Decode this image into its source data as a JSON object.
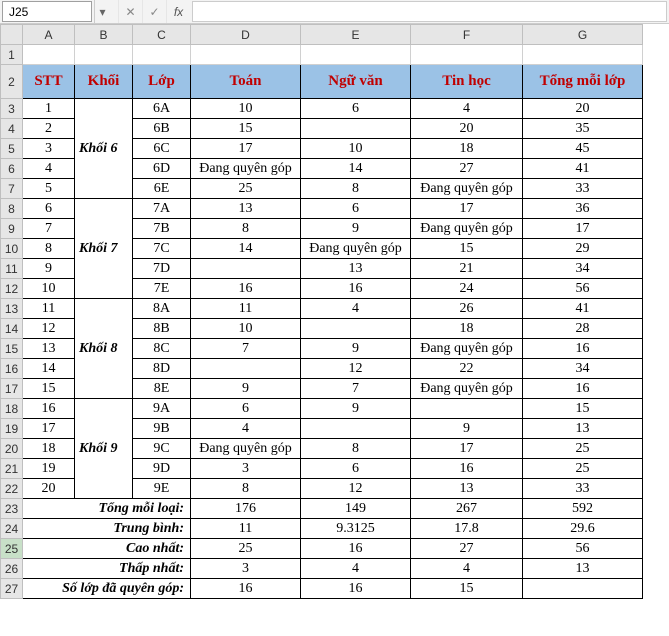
{
  "formula_bar": {
    "name_box": "J25",
    "cancel_icon": "✕",
    "enter_icon": "✓",
    "fx_label": "fx",
    "value": ""
  },
  "col_headers": [
    "A",
    "B",
    "C",
    "D",
    "E",
    "F",
    "G"
  ],
  "row_numbers": [
    1,
    2,
    3,
    4,
    5,
    6,
    7,
    8,
    9,
    10,
    11,
    12,
    13,
    14,
    15,
    16,
    17,
    18,
    19,
    20,
    21,
    22,
    23,
    24,
    25,
    26,
    27
  ],
  "headers": {
    "stt": "STT",
    "khoi": "Khối",
    "lop": "Lớp",
    "toan": "Toán",
    "nguvan": "Ngữ văn",
    "tinhoc": "Tin học",
    "tong": "Tổng mỗi lớp"
  },
  "groups": [
    {
      "name": "Khối 6",
      "rows": [
        {
          "stt": 1,
          "lop": "6A",
          "toan": "10",
          "nguvan": "6",
          "tinhoc": "4",
          "tong": "20"
        },
        {
          "stt": 2,
          "lop": "6B",
          "toan": "15",
          "nguvan": "",
          "tinhoc": "20",
          "tong": "35"
        },
        {
          "stt": 3,
          "lop": "6C",
          "toan": "17",
          "nguvan": "10",
          "tinhoc": "18",
          "tong": "45"
        },
        {
          "stt": 4,
          "lop": "6D",
          "toan": "Đang quyên góp",
          "nguvan": "14",
          "tinhoc": "27",
          "tong": "41"
        },
        {
          "stt": 5,
          "lop": "6E",
          "toan": "25",
          "nguvan": "8",
          "tinhoc": "Đang quyên góp",
          "tong": "33"
        }
      ]
    },
    {
      "name": "Khối 7",
      "rows": [
        {
          "stt": 6,
          "lop": "7A",
          "toan": "13",
          "nguvan": "6",
          "tinhoc": "17",
          "tong": "36"
        },
        {
          "stt": 7,
          "lop": "7B",
          "toan": "8",
          "nguvan": "9",
          "tinhoc": "Đang quyên góp",
          "tong": "17"
        },
        {
          "stt": 8,
          "lop": "7C",
          "toan": "14",
          "nguvan": "Đang quyên góp",
          "tinhoc": "15",
          "tong": "29"
        },
        {
          "stt": 9,
          "lop": "7D",
          "toan": "",
          "nguvan": "13",
          "tinhoc": "21",
          "tong": "34"
        },
        {
          "stt": 10,
          "lop": "7E",
          "toan": "16",
          "nguvan": "16",
          "tinhoc": "24",
          "tong": "56"
        }
      ]
    },
    {
      "name": "Khối 8",
      "rows": [
        {
          "stt": 11,
          "lop": "8A",
          "toan": "11",
          "nguvan": "4",
          "tinhoc": "26",
          "tong": "41"
        },
        {
          "stt": 12,
          "lop": "8B",
          "toan": "10",
          "nguvan": "",
          "tinhoc": "18",
          "tong": "28"
        },
        {
          "stt": 13,
          "lop": "8C",
          "toan": "7",
          "nguvan": "9",
          "tinhoc": "Đang quyên góp",
          "tong": "16"
        },
        {
          "stt": 14,
          "lop": "8D",
          "toan": "",
          "nguvan": "12",
          "tinhoc": "22",
          "tong": "34"
        },
        {
          "stt": 15,
          "lop": "8E",
          "toan": "9",
          "nguvan": "7",
          "tinhoc": "Đang quyên góp",
          "tong": "16"
        }
      ]
    },
    {
      "name": "Khối 9",
      "rows": [
        {
          "stt": 16,
          "lop": "9A",
          "toan": "6",
          "nguvan": "9",
          "tinhoc": "",
          "tong": "15"
        },
        {
          "stt": 17,
          "lop": "9B",
          "toan": "4",
          "nguvan": "",
          "tinhoc": "9",
          "tong": "13"
        },
        {
          "stt": 18,
          "lop": "9C",
          "toan": "Đang quyên góp",
          "nguvan": "8",
          "tinhoc": "17",
          "tong": "25"
        },
        {
          "stt": 19,
          "lop": "9D",
          "toan": "3",
          "nguvan": "6",
          "tinhoc": "16",
          "tong": "25"
        },
        {
          "stt": 20,
          "lop": "9E",
          "toan": "8",
          "nguvan": "12",
          "tinhoc": "13",
          "tong": "33"
        }
      ]
    }
  ],
  "summary": [
    {
      "label": "Tổng mỗi loại:",
      "toan": "176",
      "nguvan": "149",
      "tinhoc": "267",
      "tong": "592"
    },
    {
      "label": "Trung bình:",
      "toan": "11",
      "nguvan": "9.3125",
      "tinhoc": "17.8",
      "tong": "29.6"
    },
    {
      "label": "Cao nhất:",
      "toan": "25",
      "nguvan": "16",
      "tinhoc": "27",
      "tong": "56"
    },
    {
      "label": "Thấp nhất:",
      "toan": "3",
      "nguvan": "4",
      "tinhoc": "4",
      "tong": "13"
    },
    {
      "label": "Số lớp đã quyên góp:",
      "toan": "16",
      "nguvan": "16",
      "tinhoc": "15",
      "tong": ""
    }
  ],
  "active_row_header": 25
}
